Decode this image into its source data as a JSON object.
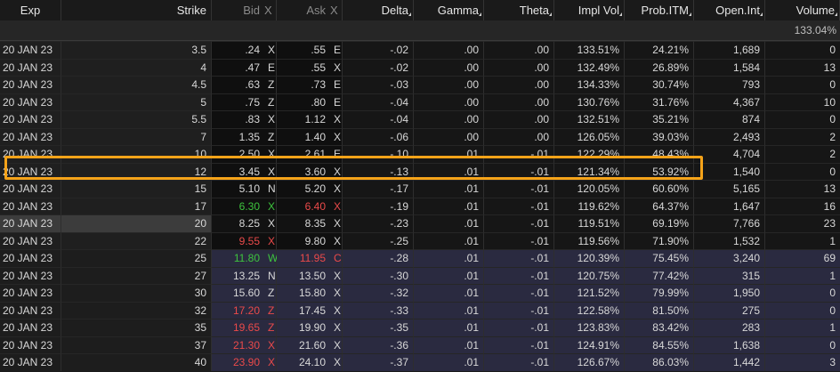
{
  "headers": {
    "exp": "Exp",
    "strike": "Strike",
    "bid": "Bid",
    "bid_x": "X",
    "ask": "Ask",
    "ask_x": "X",
    "delta": "Delta",
    "gamma": "Gamma",
    "theta": "Theta",
    "impl_vol": "Impl Vol",
    "prob_itm": "Prob.ITM",
    "open_int": "Open.Int",
    "volume": "Volume"
  },
  "summary": {
    "impl_vol": "133.04%"
  },
  "colors": {
    "highlight": "#f5a319",
    "up": "#3ec43e",
    "down": "#ea4a4a",
    "otm_bg": "#2a2a40"
  },
  "rows": [
    {
      "exp": "20 JAN 23",
      "strike": "3.5",
      "bid": ".24",
      "bid_x": "X",
      "ask": ".55",
      "ask_x": "E",
      "delta": "-.02",
      "gamma": ".00",
      "theta": ".00",
      "iv": "133.51%",
      "pitm": "24.21%",
      "oi": "1,689",
      "vol": "0",
      "zone": "itm"
    },
    {
      "exp": "20 JAN 23",
      "strike": "4",
      "bid": ".47",
      "bid_x": "E",
      "ask": ".55",
      "ask_x": "X",
      "delta": "-.02",
      "gamma": ".00",
      "theta": ".00",
      "iv": "132.49%",
      "pitm": "26.89%",
      "oi": "1,584",
      "vol": "13",
      "zone": "itm"
    },
    {
      "exp": "20 JAN 23",
      "strike": "4.5",
      "bid": ".63",
      "bid_x": "Z",
      "ask": ".73",
      "ask_x": "E",
      "delta": "-.03",
      "gamma": ".00",
      "theta": ".00",
      "iv": "134.33%",
      "pitm": "30.74%",
      "oi": "793",
      "vol": "0",
      "zone": "itm"
    },
    {
      "exp": "20 JAN 23",
      "strike": "5",
      "bid": ".75",
      "bid_x": "Z",
      "ask": ".80",
      "ask_x": "E",
      "delta": "-.04",
      "gamma": ".00",
      "theta": ".00",
      "iv": "130.76%",
      "pitm": "31.76%",
      "oi": "4,367",
      "vol": "10",
      "zone": "itm"
    },
    {
      "exp": "20 JAN 23",
      "strike": "5.5",
      "bid": ".83",
      "bid_x": "X",
      "ask": "1.12",
      "ask_x": "X",
      "delta": "-.04",
      "gamma": ".00",
      "theta": ".00",
      "iv": "132.51%",
      "pitm": "35.21%",
      "oi": "874",
      "vol": "0",
      "zone": "itm"
    },
    {
      "exp": "20 JAN 23",
      "strike": "7",
      "bid": "1.35",
      "bid_x": "Z",
      "ask": "1.40",
      "ask_x": "X",
      "delta": "-.06",
      "gamma": ".00",
      "theta": ".00",
      "iv": "126.05%",
      "pitm": "39.03%",
      "oi": "2,493",
      "vol": "2",
      "zone": "itm"
    },
    {
      "exp": "20 JAN 23",
      "strike": "10",
      "bid": "2.50",
      "bid_x": "X",
      "ask": "2.61",
      "ask_x": "E",
      "delta": "-.10",
      "gamma": ".01",
      "theta": "-.01",
      "iv": "122.29%",
      "pitm": "48.43%",
      "oi": "4,704",
      "vol": "2",
      "zone": "itm"
    },
    {
      "exp": "20 JAN 23",
      "strike": "12",
      "bid": "3.45",
      "bid_x": "X",
      "ask": "3.60",
      "ask_x": "X",
      "delta": "-.13",
      "gamma": ".01",
      "theta": "-.01",
      "iv": "121.34%",
      "pitm": "53.92%",
      "oi": "1,540",
      "vol": "0",
      "zone": "itm"
    },
    {
      "exp": "20 JAN 23",
      "strike": "15",
      "bid": "5.10",
      "bid_x": "N",
      "ask": "5.20",
      "ask_x": "X",
      "delta": "-.17",
      "gamma": ".01",
      "theta": "-.01",
      "iv": "120.05%",
      "pitm": "60.60%",
      "oi": "5,165",
      "vol": "13",
      "zone": "itm"
    },
    {
      "exp": "20 JAN 23",
      "strike": "17",
      "bid": "6.30",
      "bid_x": "X",
      "ask": "6.40",
      "ask_x": "X",
      "delta": "-.19",
      "gamma": ".01",
      "theta": "-.01",
      "iv": "119.62%",
      "pitm": "64.37%",
      "oi": "1,647",
      "vol": "16",
      "zone": "itm",
      "bid_c": "up",
      "ask_c": "dn"
    },
    {
      "exp": "20 JAN 23",
      "strike": "20",
      "bid": "8.25",
      "bid_x": "X",
      "ask": "8.35",
      "ask_x": "X",
      "delta": "-.23",
      "gamma": ".01",
      "theta": "-.01",
      "iv": "119.51%",
      "pitm": "69.19%",
      "oi": "7,766",
      "vol": "23",
      "zone": "atm"
    },
    {
      "exp": "20 JAN 23",
      "strike": "22",
      "bid": "9.55",
      "bid_x": "X",
      "ask": "9.80",
      "ask_x": "X",
      "delta": "-.25",
      "gamma": ".01",
      "theta": "-.01",
      "iv": "119.56%",
      "pitm": "71.90%",
      "oi": "1,532",
      "vol": "1",
      "zone": "itm",
      "bid_c": "dn"
    },
    {
      "exp": "20 JAN 23",
      "strike": "25",
      "bid": "11.80",
      "bid_x": "W",
      "ask": "11.95",
      "ask_x": "C",
      "delta": "-.28",
      "gamma": ".01",
      "theta": "-.01",
      "iv": "120.39%",
      "pitm": "75.45%",
      "oi": "3,240",
      "vol": "69",
      "zone": "otm",
      "bid_c": "up",
      "ask_c": "dn"
    },
    {
      "exp": "20 JAN 23",
      "strike": "27",
      "bid": "13.25",
      "bid_x": "N",
      "ask": "13.50",
      "ask_x": "X",
      "delta": "-.30",
      "gamma": ".01",
      "theta": "-.01",
      "iv": "120.75%",
      "pitm": "77.42%",
      "oi": "315",
      "vol": "1",
      "zone": "otm"
    },
    {
      "exp": "20 JAN 23",
      "strike": "30",
      "bid": "15.60",
      "bid_x": "Z",
      "ask": "15.80",
      "ask_x": "X",
      "delta": "-.32",
      "gamma": ".01",
      "theta": "-.01",
      "iv": "121.52%",
      "pitm": "79.99%",
      "oi": "1,950",
      "vol": "0",
      "zone": "otm"
    },
    {
      "exp": "20 JAN 23",
      "strike": "32",
      "bid": "17.20",
      "bid_x": "Z",
      "ask": "17.45",
      "ask_x": "X",
      "delta": "-.33",
      "gamma": ".01",
      "theta": "-.01",
      "iv": "122.58%",
      "pitm": "81.50%",
      "oi": "275",
      "vol": "0",
      "zone": "otm",
      "bid_c": "dn"
    },
    {
      "exp": "20 JAN 23",
      "strike": "35",
      "bid": "19.65",
      "bid_x": "Z",
      "ask": "19.90",
      "ask_x": "X",
      "delta": "-.35",
      "gamma": ".01",
      "theta": "-.01",
      "iv": "123.83%",
      "pitm": "83.42%",
      "oi": "283",
      "vol": "1",
      "zone": "otm",
      "bid_c": "dn"
    },
    {
      "exp": "20 JAN 23",
      "strike": "37",
      "bid": "21.30",
      "bid_x": "X",
      "ask": "21.60",
      "ask_x": "X",
      "delta": "-.36",
      "gamma": ".01",
      "theta": "-.01",
      "iv": "124.91%",
      "pitm": "84.55%",
      "oi": "1,638",
      "vol": "0",
      "zone": "otm",
      "bid_c": "dn"
    },
    {
      "exp": "20 JAN 23",
      "strike": "40",
      "bid": "23.90",
      "bid_x": "X",
      "ask": "24.10",
      "ask_x": "X",
      "delta": "-.37",
      "gamma": ".01",
      "theta": "-.01",
      "iv": "126.67%",
      "pitm": "86.03%",
      "oi": "1,442",
      "vol": "3",
      "zone": "otm",
      "bid_c": "dn"
    }
  ]
}
